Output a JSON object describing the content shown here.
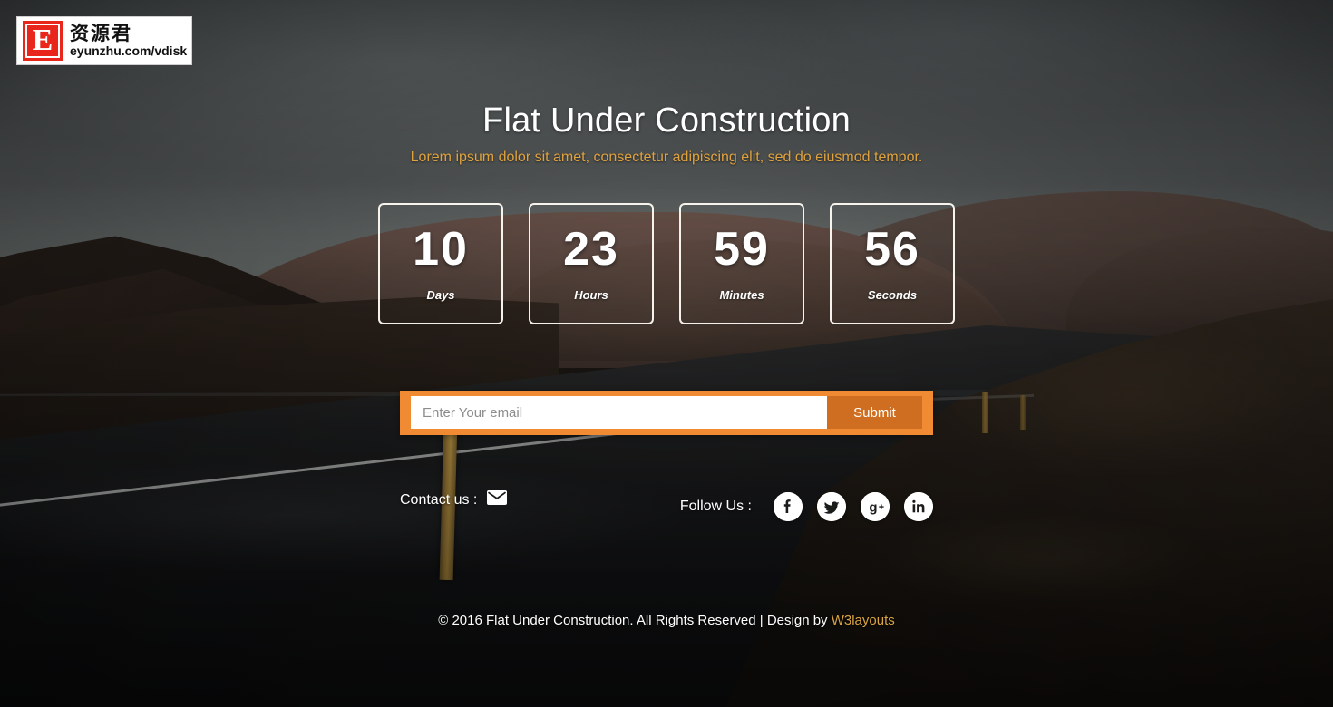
{
  "watermark": {
    "mark_letter": "E",
    "cn_text": "资源君",
    "url_text": "eyunzhu.com/vdisk"
  },
  "hero": {
    "title": "Flat Under Construction",
    "subtitle": "Lorem ipsum dolor sit amet, consectetur adipiscing elit, sed do eiusmod tempor."
  },
  "countdown": {
    "units": [
      {
        "value": "10",
        "label": "Days"
      },
      {
        "value": "23",
        "label": "Hours"
      },
      {
        "value": "59",
        "label": "Minutes"
      },
      {
        "value": "56",
        "label": "Seconds"
      }
    ]
  },
  "subscribe": {
    "email_placeholder": "Enter Your email",
    "email_value": "",
    "submit_label": "Submit"
  },
  "contact": {
    "label": "Contact us :",
    "icon": "envelope-icon"
  },
  "social": {
    "label": "Follow Us :",
    "items": [
      {
        "name": "facebook-icon",
        "glyph": "f"
      },
      {
        "name": "twitter-icon",
        "glyph": "t"
      },
      {
        "name": "googleplus-icon",
        "glyph": "g+"
      },
      {
        "name": "linkedin-icon",
        "glyph": "in"
      }
    ]
  },
  "footer": {
    "text": "© 2016 Flat Under Construction. All Rights Reserved | Design by ",
    "link_label": "W3layouts"
  },
  "colors": {
    "accent_orange": "#f08a33",
    "submit_orange": "#cf6e20",
    "subtitle_gold": "#e0a23d",
    "link_gold": "#d9a441",
    "logo_red": "#e8261c",
    "text_white": "#ffffff"
  }
}
